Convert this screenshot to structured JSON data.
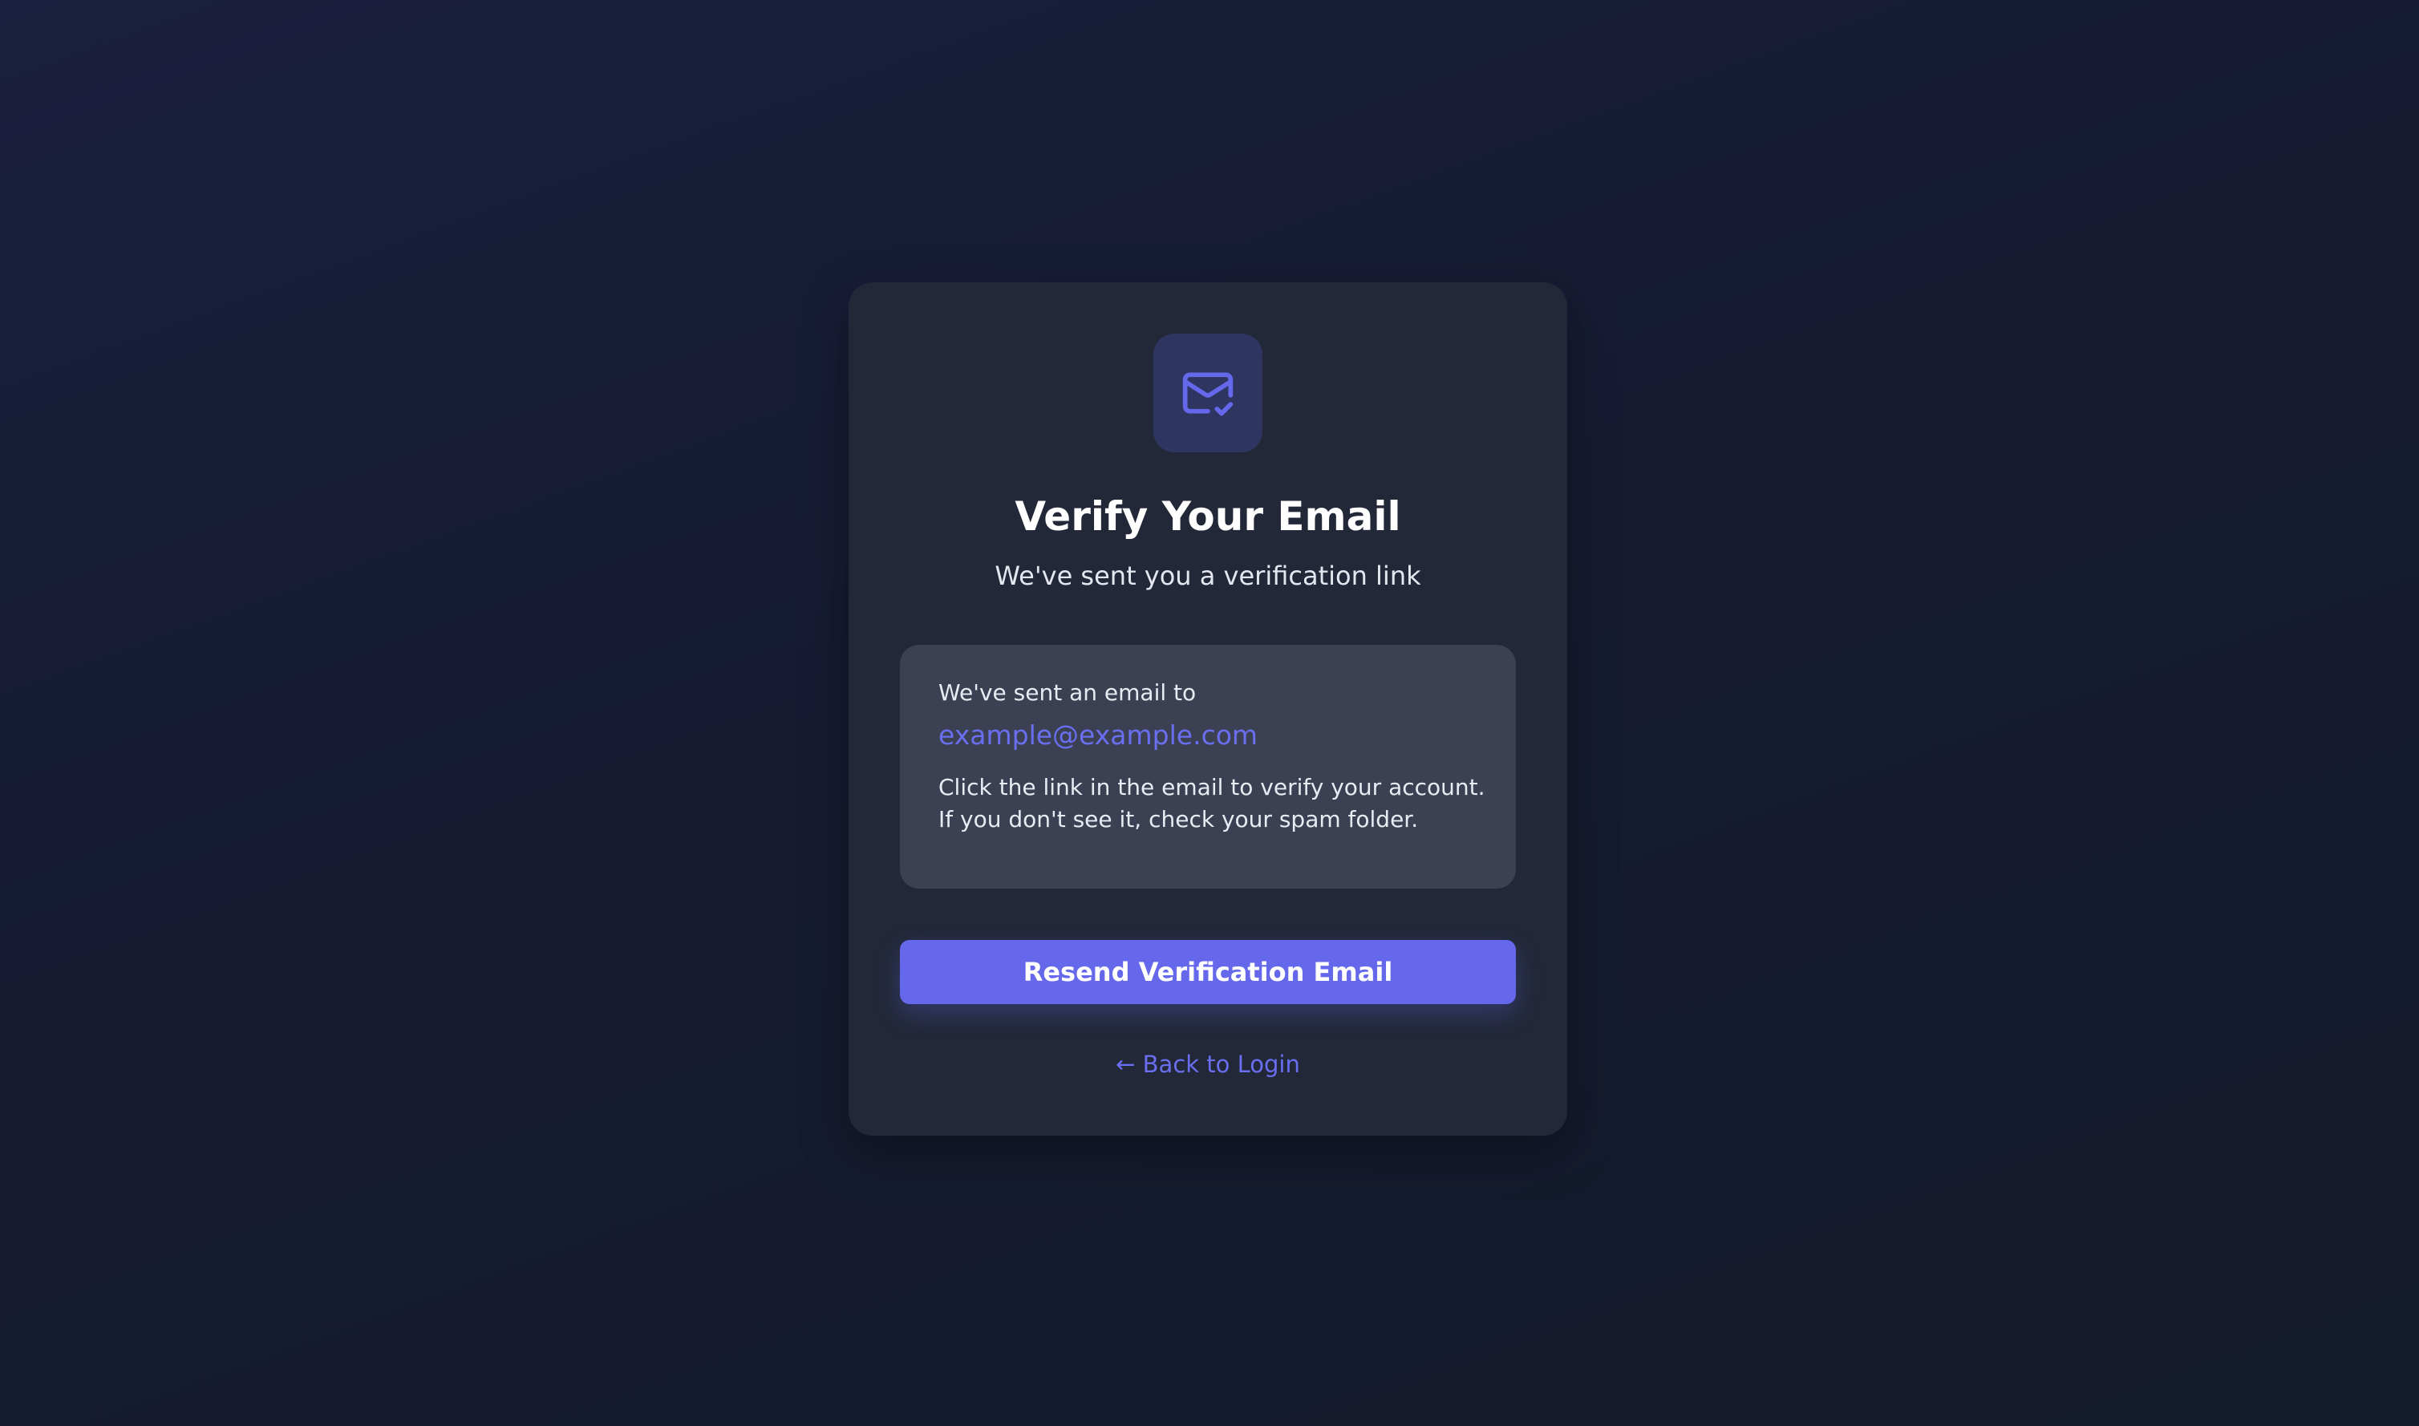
{
  "colors": {
    "accent": "#6668EC",
    "card_background": "#222838",
    "info_background": "#3B4152",
    "icon_background": "#2D3560",
    "page_background": "#171C33"
  },
  "header": {
    "icon": "mail-check-icon",
    "title": "Verify Your Email",
    "subtitle": "We've sent you a verification link"
  },
  "info": {
    "intro": "We've sent an email to",
    "email": "example@example.com",
    "instruction_line1": "Click the link in the email to verify your account.",
    "instruction_line2": "If you don't see it, check your spam folder."
  },
  "actions": {
    "resend_label": "Resend Verification Email",
    "back_arrow": "←",
    "back_label": "Back to Login"
  }
}
